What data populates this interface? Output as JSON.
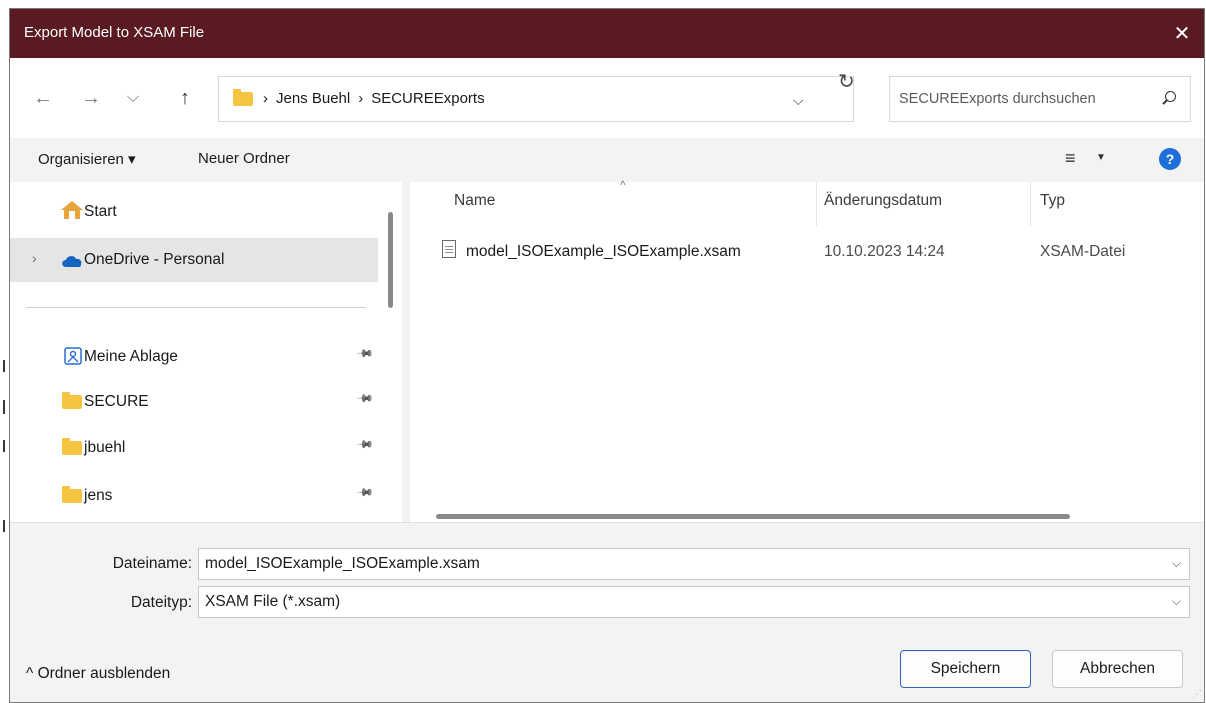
{
  "window": {
    "title": "Export Model to XSAM File",
    "close_glyph": "✕"
  },
  "nav": {
    "back_glyph": "←",
    "forward_glyph": "→",
    "recent_glyph": "⌵",
    "up_glyph": "↑",
    "breadcrumbs": [
      "Jens Buehl",
      "SECUREExports"
    ],
    "crumb_sep": "›",
    "address_dropdown_glyph": "⌵",
    "refresh_glyph": "↻",
    "search_placeholder": "SECUREExports durchsuchen"
  },
  "toolbar": {
    "organize_label": "Organisieren ▾",
    "new_folder_label": "Neuer Ordner",
    "view_glyph": "≡",
    "view_dd_glyph": "▼",
    "help_glyph": "?"
  },
  "sidebar": {
    "items": [
      {
        "label": "Start",
        "icon": "home-icon"
      },
      {
        "label": "OneDrive - Personal",
        "icon": "cloud-icon",
        "selected": true
      },
      {
        "label": "Meine Ablage",
        "icon": "drive-icon",
        "pinned": true
      },
      {
        "label": "SECURE",
        "icon": "cloud-folder-icon",
        "pinned": true
      },
      {
        "label": "jbuehl",
        "icon": "folder-icon",
        "pinned": true
      },
      {
        "label": "jens",
        "icon": "folder-icon",
        "pinned": true
      }
    ],
    "expand_glyph": "›",
    "pin_glyph": "📌"
  },
  "files": {
    "columns": [
      "Name",
      "Änderungsdatum",
      "Typ"
    ],
    "sort_glyph": "^",
    "rows": [
      {
        "name": "model_ISOExample_ISOExample.xsam",
        "date": "10.10.2023 14:24",
        "type": "XSAM-Datei"
      }
    ]
  },
  "form": {
    "filename_label": "Dateiname:",
    "filename_value": "model_ISOExample_ISOExample.xsam",
    "filetype_label": "Dateityp:",
    "filetype_value": "XSAM File (*.xsam)",
    "dd_glyph": "⌵"
  },
  "footer": {
    "hide_folders_label": "^  Ordner ausblenden",
    "save_label": "Speichern",
    "cancel_label": "Abbrechen"
  },
  "colors": {
    "titlebar": "#5a1a22",
    "accent": "#2c62c4",
    "folder": "#f5c542"
  }
}
